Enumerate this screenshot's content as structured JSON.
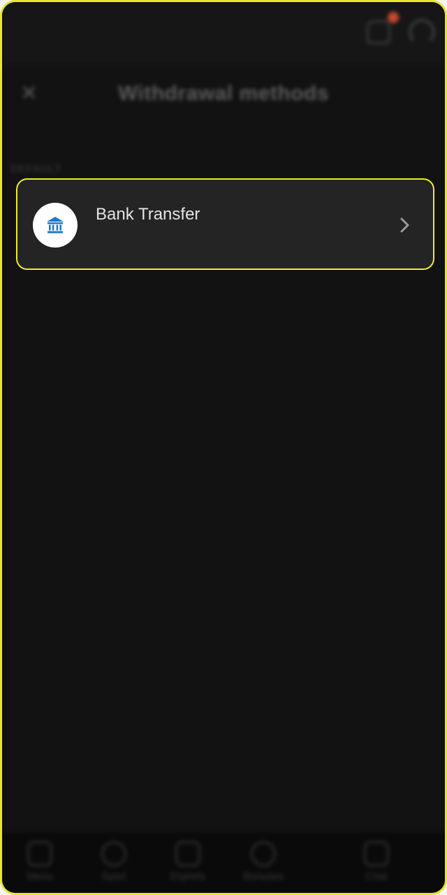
{
  "header": {
    "close_label": "✕",
    "title": "Withdrawal methods"
  },
  "section": {
    "label": "DEFAULT"
  },
  "methods": [
    {
      "label": "Bank Transfer",
      "icon": "bank-icon"
    }
  ],
  "bottom_nav": [
    {
      "label": "Menu",
      "icon": "menu-icon"
    },
    {
      "label": "Sport",
      "icon": "sport-icon"
    },
    {
      "label": "Esports",
      "icon": "gamepad-icon"
    },
    {
      "label": "Bonuses",
      "icon": "bonus-icon"
    },
    {
      "label": "Chat",
      "icon": "chat-icon"
    }
  ],
  "colors": {
    "highlight": "#ecec32",
    "bank_icon": "#1e78c8",
    "notification_dot": "#c84a2c",
    "background": "#121212"
  }
}
